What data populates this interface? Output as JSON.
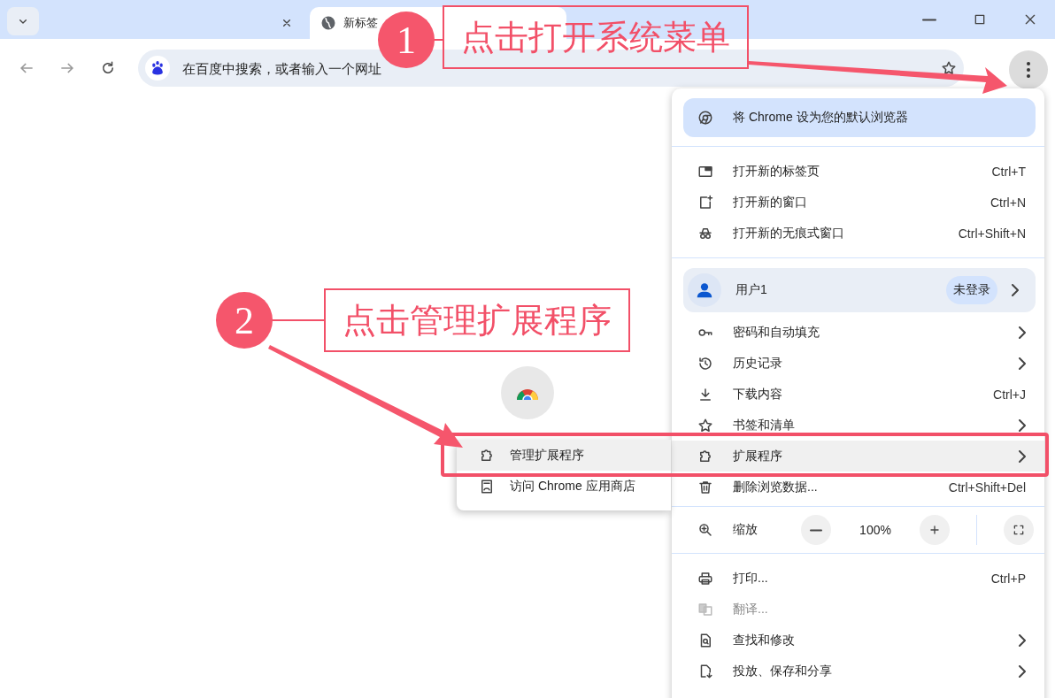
{
  "tab_strip": {
    "tabs": [
      {
        "selected": false
      },
      {
        "title": "新标签",
        "selected": true
      }
    ]
  },
  "toolbar": {
    "address_bar": {
      "placeholder": "在百度中搜索，或者输入一个网址"
    }
  },
  "menu": {
    "sections": [
      [
        {
          "kind": "promo",
          "label": "将 Chrome 设为您的默认浏览器"
        }
      ],
      [
        {
          "kind": "item",
          "label": "打开新的标签页",
          "shortcut": "Ctrl+T",
          "submenu": false,
          "highlighted": false,
          "disabled": false
        },
        {
          "kind": "item",
          "label": "打开新的窗口",
          "shortcut": "Ctrl+N",
          "submenu": false,
          "highlighted": false,
          "disabled": false
        },
        {
          "kind": "item",
          "label": "打开新的无痕式窗口",
          "shortcut": "Ctrl+Shift+N",
          "submenu": false,
          "highlighted": false,
          "disabled": false
        }
      ],
      [
        {
          "kind": "profile",
          "label": "用户1",
          "badge": "未登录",
          "submenu": true
        },
        {
          "kind": "item",
          "label": "密码和自动填充",
          "submenu": true,
          "highlighted": false,
          "disabled": false
        },
        {
          "kind": "item",
          "label": "历史记录",
          "submenu": true,
          "highlighted": false,
          "disabled": false
        },
        {
          "kind": "item",
          "label": "下载内容",
          "shortcut": "Ctrl+J",
          "submenu": false,
          "highlighted": false,
          "disabled": false
        },
        {
          "kind": "item",
          "label": "书签和清单",
          "submenu": true,
          "highlighted": false,
          "disabled": false
        },
        {
          "kind": "item",
          "label": "扩展程序",
          "submenu": true,
          "highlighted": true,
          "disabled": false
        },
        {
          "kind": "item",
          "label": "删除浏览数据...",
          "shortcut": "Ctrl+Shift+Del",
          "submenu": false,
          "highlighted": false,
          "disabled": false
        }
      ],
      [
        {
          "kind": "zoom",
          "label": "缩放",
          "value": "100%"
        }
      ],
      [
        {
          "kind": "item",
          "label": "打印...",
          "shortcut": "Ctrl+P",
          "submenu": false,
          "highlighted": false,
          "disabled": false
        },
        {
          "kind": "item",
          "label": "翻译...",
          "submenu": false,
          "highlighted": false,
          "disabled": true
        },
        {
          "kind": "item",
          "label": "查找和修改",
          "submenu": true,
          "highlighted": false,
          "disabled": false
        },
        {
          "kind": "item",
          "label": "投放、保存和分享",
          "submenu": true,
          "highlighted": false,
          "disabled": false
        }
      ]
    ]
  },
  "submenu": {
    "items": [
      {
        "label": "管理扩展程序",
        "highlighted": true
      },
      {
        "label": "访问 Chrome 应用商店",
        "highlighted": false
      }
    ]
  },
  "annotations": [
    {
      "number": "1",
      "text": "点击打开系统菜单"
    },
    {
      "number": "2",
      "text": "点击管理扩展程序"
    }
  ]
}
